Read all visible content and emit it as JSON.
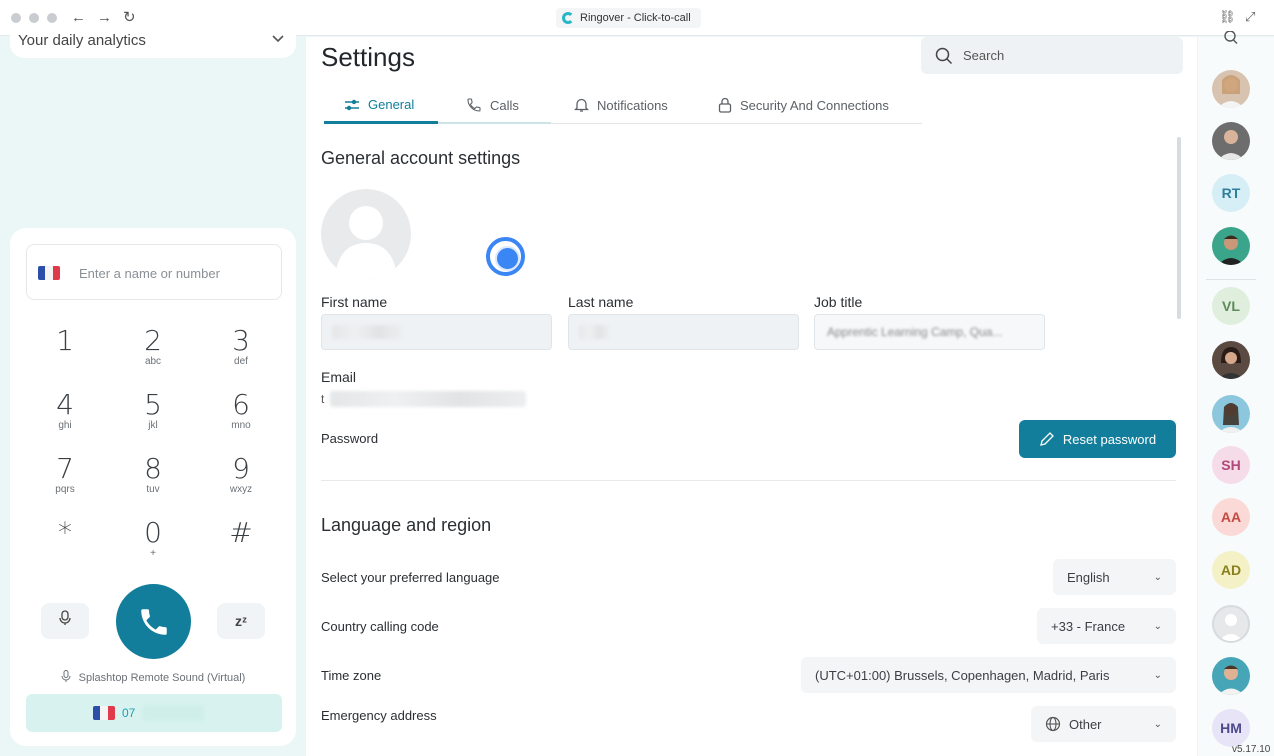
{
  "window": {
    "title": "Ringover - Click-to-call"
  },
  "left": {
    "analytics_label": "Your daily analytics",
    "dial_placeholder": "Enter a name or number",
    "keys": [
      {
        "digit": "1",
        "letters": ""
      },
      {
        "digit": "2",
        "letters": "abc"
      },
      {
        "digit": "3",
        "letters": "def"
      },
      {
        "digit": "4",
        "letters": "ghi"
      },
      {
        "digit": "5",
        "letters": "jkl"
      },
      {
        "digit": "6",
        "letters": "mno"
      },
      {
        "digit": "7",
        "letters": "pqrs"
      },
      {
        "digit": "8",
        "letters": "tuv"
      },
      {
        "digit": "9",
        "letters": "wxyz"
      },
      {
        "digit": "*",
        "letters": ""
      },
      {
        "digit": "0",
        "letters": "+"
      },
      {
        "digit": "#",
        "letters": ""
      }
    ],
    "snooze_label": "zᶻ",
    "device_label": "Splashtop Remote Sound (Virtual)",
    "caller_number_prefix": "07"
  },
  "settings": {
    "title": "Settings",
    "search_placeholder": "Search",
    "tabs": [
      {
        "label": "General",
        "active": true
      },
      {
        "label": "Calls",
        "active": false
      },
      {
        "label": "Notifications",
        "active": false
      },
      {
        "label": "Security And Connections",
        "active": false
      }
    ],
    "general": {
      "section_title": "General account settings",
      "first_name_label": "First name",
      "last_name_label": "Last name",
      "job_title_label": "Job title",
      "job_title_value": "Apprentic Learning Camp, Qua...",
      "email_label": "Email",
      "email_prefix": "t",
      "password_label": "Password",
      "reset_password": "Reset password"
    },
    "language": {
      "section_title": "Language and region",
      "language_label": "Select your preferred language",
      "language_value": "English",
      "country_label": "Country calling code",
      "country_value": "+33 - France",
      "timezone_label": "Time zone",
      "timezone_value": "(UTC+01:00) Brussels, Copenhagen, Madrid, Paris",
      "emergency_label": "Emergency address",
      "emergency_value": "Other"
    }
  },
  "rail": {
    "initials": [
      "RT",
      "VL",
      "SH",
      "AA",
      "AD",
      "HM"
    ],
    "version": "v5.17.10"
  },
  "colors": {
    "primary": "#127e9b",
    "accent": "#27b7c9"
  }
}
